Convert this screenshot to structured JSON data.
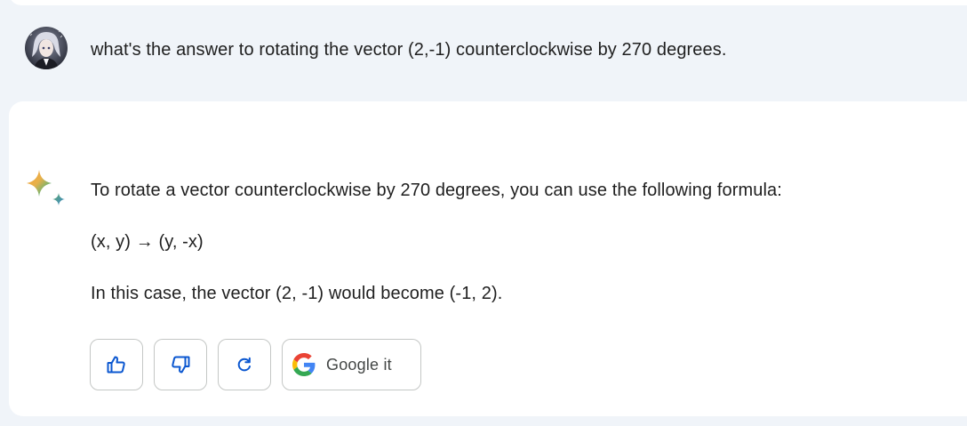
{
  "user_message": {
    "text": "what's the answer to rotating the vector (2,-1) counterclockwise by 270 degrees."
  },
  "response": {
    "lines": [
      "To rotate a vector counterclockwise by 270 degrees, you can use the following formula:",
      "(x, y) → (y, -x)",
      "In this case, the vector (2, -1) would become (-1, 2)."
    ]
  },
  "actions": {
    "thumbs_up_icon": "thumbs-up-icon",
    "thumbs_down_icon": "thumbs-down-icon",
    "redo_icon": "redo-icon",
    "google_label": "Google it"
  },
  "colors": {
    "page_bg": "#f0f4f9",
    "card_bg": "#ffffff",
    "accent_blue": "#0b57d0",
    "text": "#1f1f1f"
  }
}
